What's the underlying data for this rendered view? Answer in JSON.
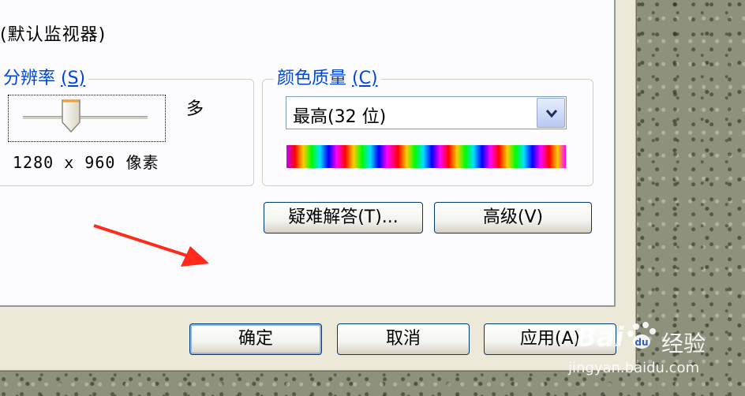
{
  "monitor_label": "(默认监视器)",
  "resolution_group": {
    "title_prefix": "分辨率 ",
    "title_key": "(S)",
    "more_label": "多",
    "resolution_text": "1280 x 960 像素"
  },
  "color_group": {
    "title_prefix": "颜色质量 ",
    "title_key": "(C)",
    "selected_value": "最高(32 位)",
    "dropdown_icon": "chevron-down-icon"
  },
  "buttons": {
    "troubleshoot": "疑难解答(T)...",
    "advanced": "高级(V)",
    "ok": "确定",
    "cancel": "取消",
    "apply": "应用(A)"
  },
  "annotation": {
    "arrow_color": "#ff2a1a"
  },
  "watermark": {
    "logo": "Bai",
    "brand": "经验",
    "url": "jingyan.baidu.com"
  },
  "colors": {
    "accent_blue": "#0046d5",
    "dialog_bg": "#ece9d8"
  }
}
